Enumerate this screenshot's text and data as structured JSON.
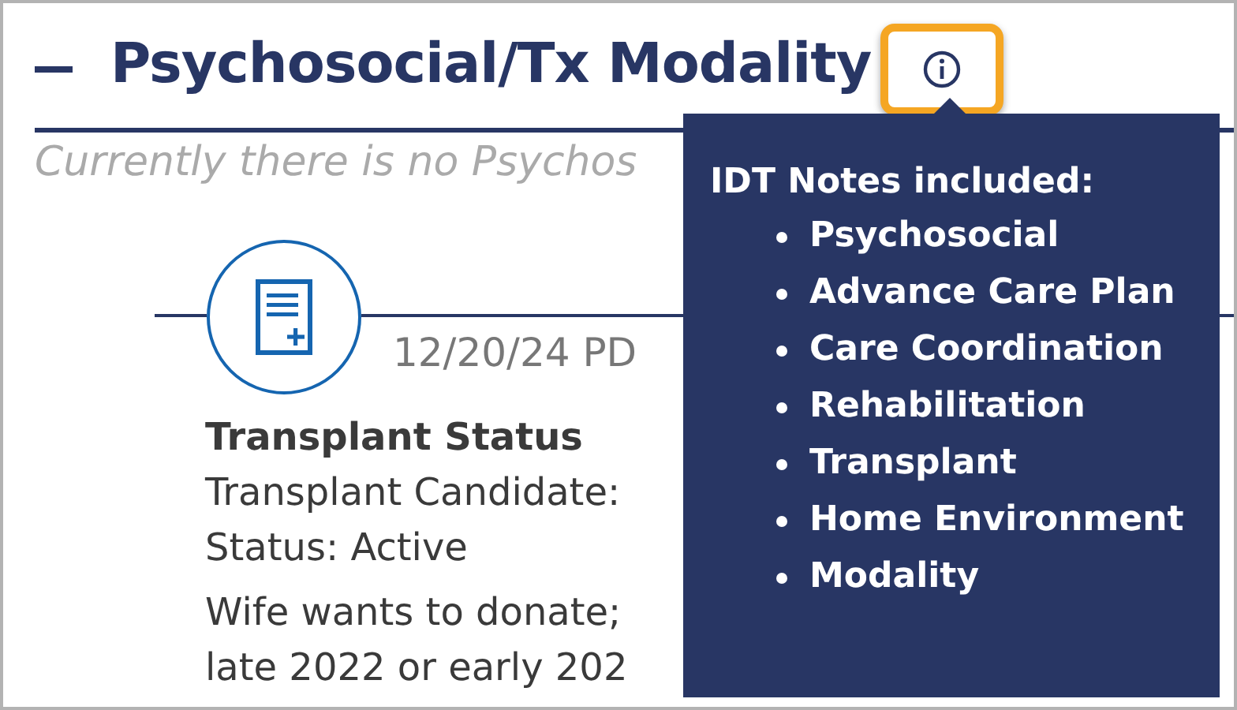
{
  "section": {
    "title": "Psychosocial/Tx Modality",
    "expanded": true,
    "info_button": {
      "highlighted": true
    },
    "empty_message": "Currently there is no Psychos"
  },
  "note": {
    "date": "12/20/24 PD",
    "heading": "Transplant Status",
    "lines": [
      "Transplant Candidate:",
      "Status: Active"
    ],
    "paragraph": [
      "Wife wants to donate;",
      "late 2022 or early 202"
    ]
  },
  "tooltip": {
    "title": "IDT Notes included:",
    "items": [
      "Psychosocial",
      "Advance Care Plan",
      "Care Coordination",
      "Rehabilitation",
      "Transplant",
      "Home Environment",
      "Modality"
    ]
  }
}
